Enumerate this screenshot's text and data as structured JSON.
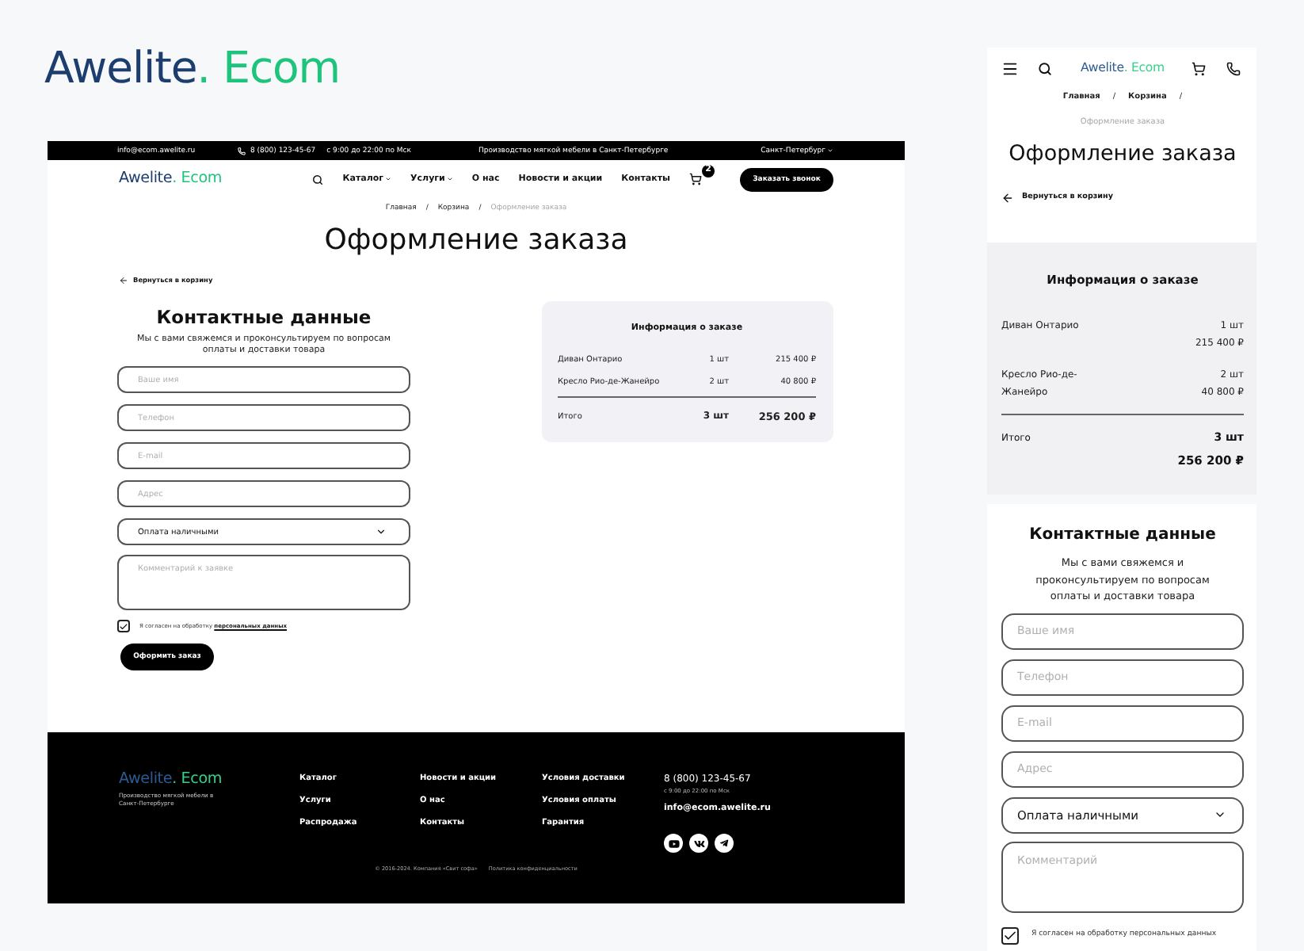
{
  "presentation_logo": {
    "primary": "Awelite",
    "accent": ". Ecom"
  },
  "desktop": {
    "top_bar": {
      "email": "info@ecom.awelite.ru",
      "phone": "8 (800) 123-45-67",
      "hours": "с 9:00 до 22:00 по Мск",
      "tagline": "Производство мягкой мебели в Санкт-Петербурге",
      "city": "Санкт-Петербург"
    },
    "header": {
      "logo": {
        "primary": "Awelite",
        "accent": ". Ecom"
      },
      "nav": [
        {
          "label": "Каталог",
          "has_dropdown": true
        },
        {
          "label": "Услуги",
          "has_dropdown": true
        },
        {
          "label": "О нас",
          "has_dropdown": false
        },
        {
          "label": "Новости и акции",
          "has_dropdown": false
        },
        {
          "label": "Контакты",
          "has_dropdown": false
        }
      ],
      "cart_count": "2",
      "callback_button": "Заказать звонок"
    },
    "breadcrumbs": [
      {
        "label": "Главная",
        "current": false,
        "separator": "/"
      },
      {
        "label": "Корзина",
        "current": false,
        "separator": "/"
      },
      {
        "label": "Оформление заказа",
        "current": true
      }
    ],
    "title": "Оформление заказа",
    "back_link": "Вернуться в корзину",
    "contact": {
      "heading": "Контактные данные",
      "subtitle": "Мы с вами свяжемся и проконсультируем по вопросам оплаты и доставки товара",
      "fields": [
        {
          "kind": "input",
          "placeholder": "Ваше имя"
        },
        {
          "kind": "input",
          "placeholder": "Телефон"
        },
        {
          "kind": "input",
          "placeholder": "E-mail"
        },
        {
          "kind": "input",
          "placeholder": "Адрес"
        },
        {
          "kind": "select",
          "value": "Оплата наличными"
        },
        {
          "kind": "textarea",
          "placeholder": "Комментарий к заявке"
        }
      ],
      "consent": {
        "checked": true,
        "text": "Я согласен на обработку",
        "link": "персональных данных"
      },
      "submit_button": "Оформить заказ"
    },
    "order": {
      "heading": "Информация о заказе",
      "items": [
        {
          "name": "Диван Онтарио",
          "qty": "1 шт",
          "price": "215 400 ₽"
        },
        {
          "name": "Кресло Рио-де-Жанейро",
          "qty": "2 шт",
          "price": "40 800 ₽"
        }
      ],
      "total": {
        "label": "Итого",
        "qty": "3 шт",
        "price": "256 200 ₽"
      }
    },
    "footer": {
      "logo": {
        "primary": "Awelite",
        "accent": ". Ecom"
      },
      "tagline": "Производство мягкой мебели в Санкт-Петербурге",
      "link_columns": [
        {
          "links": [
            "Каталог",
            "Услуги",
            "Распродажа"
          ]
        },
        {
          "links": [
            "Новости и акции",
            "О нас",
            "Контакты"
          ]
        },
        {
          "links": [
            "Условия доставки",
            "Условия оплаты",
            "Гарантия"
          ]
        }
      ],
      "phone": "8 (800) 123-45-67",
      "hours": "с 9:00 до 22:00 по Мск",
      "email": "info@ecom.awelite.ru",
      "copyright": "© 2016-2024. Компания «Свит софа»",
      "privacy_link": "Политика конфиденциальности"
    }
  },
  "mobile": {
    "header": {
      "logo": {
        "primary": "Awelite",
        "accent": ". Ecom"
      }
    },
    "breadcrumbs": [
      {
        "label": "Главная",
        "current": false,
        "separator": "/"
      },
      {
        "label": "Корзина",
        "current": false,
        "separator": "/"
      },
      {
        "label": "Оформление заказа",
        "current": true
      }
    ],
    "title": "Оформление заказа",
    "back_link": "Вернуться в корзину",
    "order": {
      "heading": "Информация о заказе",
      "items": [
        {
          "name": "Диван Онтарио",
          "qty": "1 шт",
          "price": "215 400 ₽"
        },
        {
          "name": "Кресло Рио-де-Жанейро",
          "qty": "2 шт",
          "price": "40 800 ₽"
        }
      ],
      "total": {
        "label": "Итого",
        "qty": "3 шт",
        "price": "256 200 ₽"
      }
    },
    "contact": {
      "heading": "Контактные данные",
      "subtitle": "Мы с вами свяжемся и проконсультируем по вопросам оплаты и доставки товара",
      "fields": [
        {
          "kind": "input",
          "placeholder": "Ваше имя"
        },
        {
          "kind": "input",
          "placeholder": "Телефон"
        },
        {
          "kind": "input",
          "placeholder": "E-mail"
        },
        {
          "kind": "input",
          "placeholder": "Адрес"
        },
        {
          "kind": "select",
          "value": "Оплата наличными"
        },
        {
          "kind": "textarea",
          "placeholder": "Комментарий"
        }
      ],
      "consent": {
        "checked": true,
        "text": "Я согласен на обработку персональных данных"
      }
    }
  }
}
